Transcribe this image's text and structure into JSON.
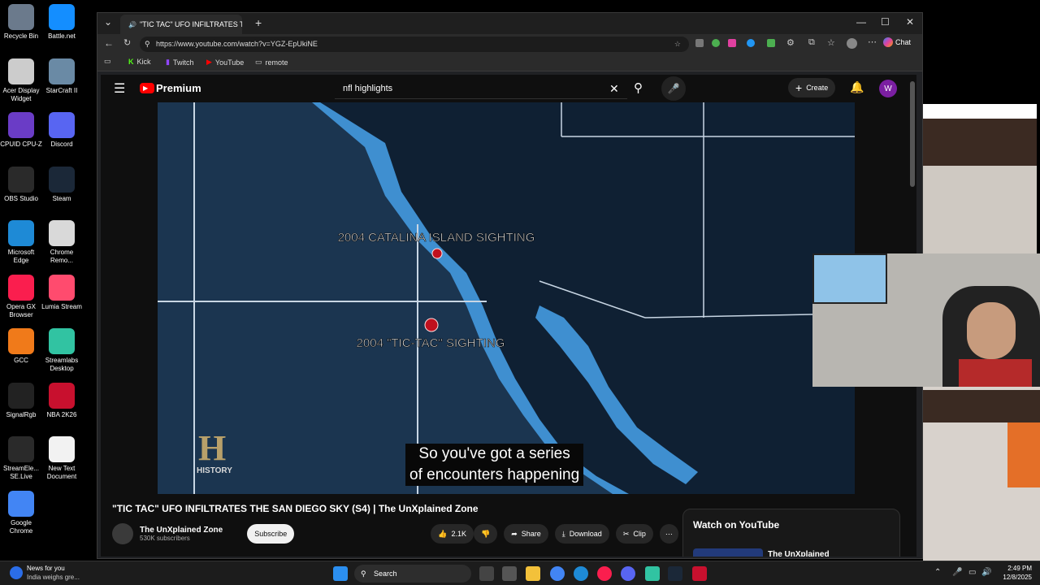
{
  "desktop_icons": [
    {
      "label": "Recycle Bin",
      "icon": "recycle-bin-icon",
      "color": "#6b7a8c"
    },
    {
      "label": "Battle.net",
      "icon": "battlenet-icon",
      "color": "#148eff"
    },
    {
      "label": "Acer Display Widget",
      "icon": "acer-display-icon",
      "color": "#cccccc"
    },
    {
      "label": "StarCraft II",
      "icon": "starcraft-icon",
      "color": "#6a8aa5"
    },
    {
      "label": "CPUID CPU-Z",
      "icon": "cpuz-icon",
      "color": "#6a3cc6"
    },
    {
      "label": "Discord",
      "icon": "discord-icon",
      "color": "#5865f2"
    },
    {
      "label": "OBS Studio",
      "icon": "obs-icon",
      "color": "#2a2a2a"
    },
    {
      "label": "Steam",
      "icon": "steam-icon",
      "color": "#1b2838"
    },
    {
      "label": "Microsoft Edge",
      "icon": "edge-icon",
      "color": "#1e8ad6"
    },
    {
      "label": "Chrome Remo...",
      "icon": "chrome-remote-icon",
      "color": "#d9d9d9"
    },
    {
      "label": "Opera GX Browser",
      "icon": "operagx-icon",
      "color": "#fa1e4e"
    },
    {
      "label": "Lumia Stream",
      "icon": "lumia-icon",
      "color": "#ff4b6e"
    },
    {
      "label": "GCC",
      "icon": "gcc-icon",
      "color": "#f07a1a"
    },
    {
      "label": "Streamlabs Desktop",
      "icon": "streamlabs-icon",
      "color": "#31c3a2"
    },
    {
      "label": "SignalRgb",
      "icon": "signalrgb-icon",
      "color": "#222222"
    },
    {
      "label": "NBA 2K26",
      "icon": "nba2k-icon",
      "color": "#c8102e"
    },
    {
      "label": "StreamEle... SE.Live",
      "icon": "streamelements-icon",
      "color": "#2a2a2a"
    },
    {
      "label": "New Text Document",
      "icon": "text-document-icon",
      "color": "#f2f2f2"
    },
    {
      "label": "Google Chrome",
      "icon": "chrome-icon",
      "color": "#4285f4"
    }
  ],
  "browser": {
    "tab_title": "\"TIC TAC\" UFO INFILTRATES TH",
    "url": "https://www.youtube.com/watch?v=YGZ-EpUkiNE",
    "chat_label": "Chat",
    "favorites": [
      "Kick",
      "Twitch",
      "YouTube",
      "remote"
    ]
  },
  "youtube": {
    "logo": "Premium",
    "search_value": "nfl highlights",
    "create_label": "Create",
    "avatar_letter": "W",
    "video": {
      "map_label_1": "2004 CATALINA ISLAND SIGHTING",
      "map_label_2": "2004 \"TIC-TAC\" SIGHTING",
      "watermark": "HISTORY",
      "caption_line1": "So you've got a series",
      "caption_line2": "of encounters happening"
    },
    "title": "\"TIC TAC\" UFO INFILTRATES THE SAN DIEGO SKY (S4) | The UnXplained Zone",
    "channel_name": "The UnXplained Zone",
    "subscribers": "530K subscribers",
    "subscribe_label": "Subscribe",
    "likes": "2.1K",
    "share_label": "Share",
    "download_label": "Download",
    "clip_label": "Clip",
    "watch_on_youtube": "Watch on YouTube",
    "related_channel": "The UnXplained"
  },
  "taskbar": {
    "news_title": "News for you",
    "news_sub": "India weighs gre...",
    "search_label": "Search",
    "time": "2:49 PM",
    "date": "12/8/2025"
  },
  "colors": {
    "yt_red": "#ff0000",
    "ocean": "#1b3550",
    "land": "#3f8fd0",
    "subscribe_bg": "#f1f1f1",
    "avatar": "#7b1fa2"
  }
}
